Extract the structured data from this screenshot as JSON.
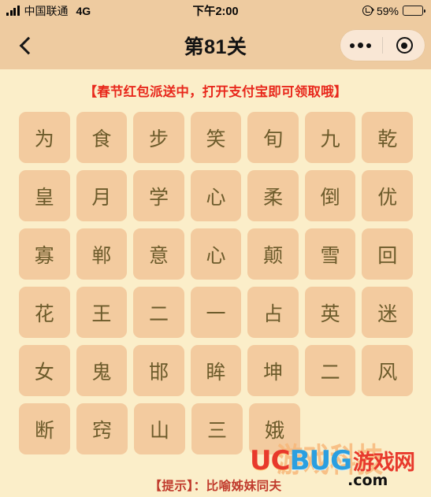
{
  "status_bar": {
    "carrier": "中国联通",
    "network_type": "4G",
    "time": "下午2:00",
    "battery_percent": "59%",
    "battery_level": 59,
    "signal_bars": 4,
    "lock_icon": "rotation-lock-icon"
  },
  "nav_bar": {
    "back_icon": "back-chevron-icon",
    "title": "第81关",
    "capsule": {
      "more_icon": "more-dots-icon",
      "target_icon": "target-circle-icon"
    }
  },
  "promo": {
    "text": "【春节红包派送中，打开支付宝即可领取哦】",
    "color": "#e8281c"
  },
  "grid": {
    "rows": [
      [
        "为",
        "食",
        "步",
        "笑",
        "旬",
        "九",
        "乾"
      ],
      [
        "皇",
        "月",
        "学",
        "心",
        "柔",
        "倒",
        "优"
      ],
      [
        "寡",
        "郸",
        "意",
        "心",
        "颠",
        "雪",
        "回"
      ],
      [
        "花",
        "王",
        "二",
        "一",
        "占",
        "英",
        "迷"
      ],
      [
        "女",
        "鬼",
        "邯",
        "眸",
        "坤",
        "二",
        "风"
      ],
      [
        "断",
        "窍",
        "山",
        "三",
        "娥"
      ]
    ],
    "tile_color": "#f3cb9f",
    "text_color": "#6c5b2b"
  },
  "watermark": {
    "brand_uc": "UC",
    "brand_bug": "BUG",
    "brand_cn": "游戏网",
    "domain_suffix": ".com",
    "ghost_text": "游戏科技"
  },
  "hint": {
    "label": "【提示】：",
    "text": "比喻姊妹同夫",
    "color": "#c0392b"
  },
  "theme": {
    "page_background": "#fbeec9",
    "bar_background": "#eecba0",
    "capsule_background": "#f9e7d5"
  }
}
